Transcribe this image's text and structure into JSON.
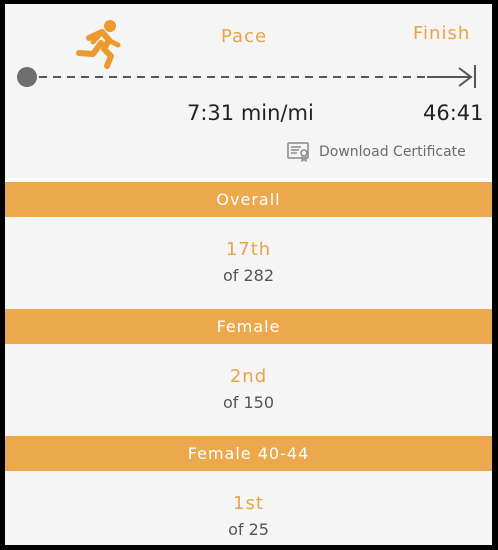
{
  "top": {
    "pace_label": "Pace",
    "finish_label": "Finish",
    "pace_value": "7:31 min/mi",
    "finish_value": "46:41",
    "download_label": "Download Certificate",
    "runner_icon": "running-person-icon",
    "certificate_icon": "certificate-icon"
  },
  "rankings": [
    {
      "category": "Overall",
      "place": "17th",
      "total": "of 282"
    },
    {
      "category": "Female",
      "place": "2nd",
      "total": "of 150"
    },
    {
      "category": "Female 40-44",
      "place": "1st",
      "total": "of 25"
    }
  ],
  "colors": {
    "accent": "#eba84c",
    "text": "#222222",
    "muted": "#6b6b6b",
    "background": "#f5f5f5"
  }
}
